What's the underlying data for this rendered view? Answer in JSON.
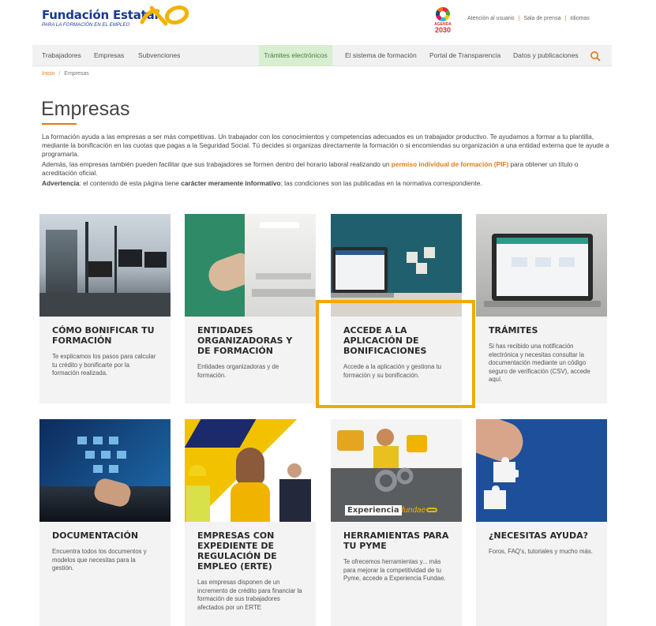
{
  "header": {
    "logo_title": "Fundación Estatal",
    "logo_subtitle": "PARA LA FORMACIÓN EN EL EMPLEO",
    "agenda_line1": "AGENDA",
    "agenda_line2": "2030",
    "links": [
      "Atención al usuario",
      "Sala de prensa",
      "Idiomas"
    ],
    "link_separator": "|"
  },
  "nav": {
    "items": [
      "Trabajadores",
      "Empresas",
      "Subvenciones",
      "Trámites electrónicos",
      "El sistema de formación",
      "Portal de Transparencia",
      "Datos y publicaciones"
    ],
    "active_index": 3
  },
  "breadcrumb": {
    "home": "Inicio",
    "separator": "/",
    "current": "Empresas"
  },
  "page_title": "Empresas",
  "intro": {
    "p1": "La formación ayuda a las empresas a ser más competitivas. Un trabajador con los conocimientos y competencias adecuados es un trabajador productivo. Te ayudamos a formar a tu plantilla, mediante la bonificación en las cuotas que pagas a la Seguridad Social. Tú decides si organizas directamente la formación o si encomiendas su organización a una entidad externa que te ayude a programarla.",
    "p2_before": "Además, las empresas también pueden facilitar que sus trabajadores se formen dentro del horario laboral realizando un ",
    "p2_link": "permiso individual de formación (PIF)",
    "p2_after": " para obtener un título o acreditación oficial.",
    "p3_label": "Advertencia",
    "p3_mid": ": el contenido de esta página tiene ",
    "p3_bold": "carácter meramente informativo",
    "p3_after": "; las condiciones son las publicadas en la normativa correspondiente."
  },
  "cards": [
    {
      "title": "CÓMO BONIFICAR TU FORMACIÓN",
      "desc": "Te explicamos los pasos para calcular tu crédito y bonificarte por la formación realizada."
    },
    {
      "title": "ENTIDADES ORGANIZADORAS Y DE FORMACIÓN",
      "desc": "Entidades organizadoras y de formación."
    },
    {
      "title": "ACCEDE A LA APLICACIÓN DE BONIFICACIONES",
      "desc": "Accede a la aplicación y gestiona tu formación y su bonificación."
    },
    {
      "title": "TRÁMITES",
      "desc": "Si has recibido una notificación electrónica y necesitas consultar la documentación mediante un código seguro de verificación (CSV), accede aquí."
    },
    {
      "title": "DOCUMENTACIÓN",
      "desc": "Encuentra todos los documentos y modelos que necesitas para la gestión."
    },
    {
      "title": "EMPRESAS CON EXPEDIENTE DE REGULACIÓN DE EMPLEO (ERTE)",
      "desc": "Las empresas disponen de un incremento de crédito para financiar la formación de sus trabajadores afectados por un ERTE"
    },
    {
      "title": "HERRAMIENTAS PARA TU PYME",
      "desc": "Te ofrecemos herramientas y... más para mejorar la competitividad de tu Pyme, accede a Experiencia Fundae."
    },
    {
      "title": "¿NECESITAS AYUDA?",
      "desc": "Foros, FAQ's, tutoriales y mucho más."
    }
  ],
  "experiencia_label": "Experiencia",
  "experiencia_brand": "fundae",
  "colors": {
    "accent": "#e07b1a",
    "brand_blue": "#1a3a8f",
    "highlight": "#f2a900",
    "nav_active": "#d7eed0"
  }
}
